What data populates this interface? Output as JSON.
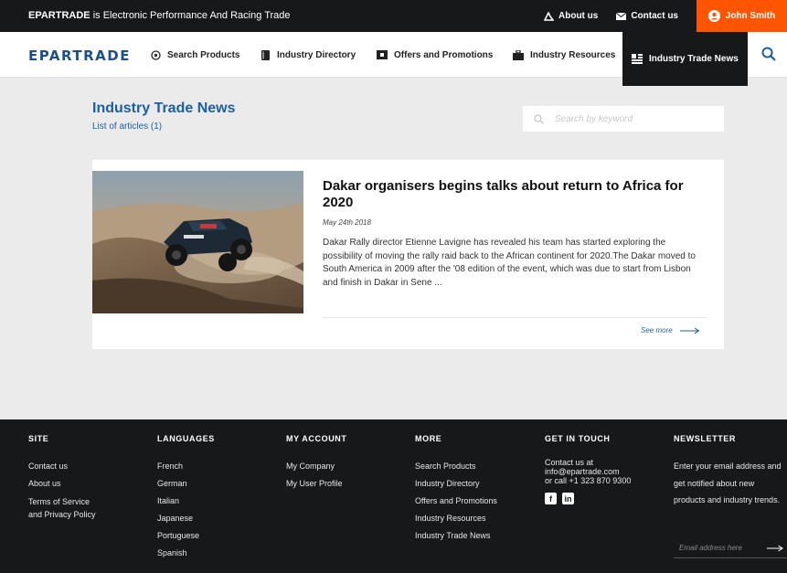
{
  "topbar": {
    "brand": "EPARTRADE",
    "tagline_rest": " is Electronic Performance And Racing Trade",
    "about_label": "About us",
    "contact_label": "Contact us",
    "user_name": "John Smith"
  },
  "nav": {
    "logo_text": "EPARTRADE",
    "items": [
      {
        "label": "Search Products",
        "icon": "target-icon"
      },
      {
        "label": "Industry Directory",
        "icon": "book-icon"
      },
      {
        "label": "Offers and Promotions",
        "icon": "ticket-icon"
      },
      {
        "label": "Industry Resources",
        "icon": "briefcase-icon"
      },
      {
        "label": "Industry Trade News",
        "icon": "news-icon"
      }
    ]
  },
  "main": {
    "title": "Industry Trade News",
    "subtitle": "List of articles (1)",
    "search_placeholder": "Search by keyword"
  },
  "article": {
    "title": "Dakar organisers begins talks about return to Africa for 2020",
    "date": "May 24th 2018",
    "body": "Dakar Rally director Etienne Lavigne has revealed his team has started exploring the possibility of moving the rally raid back to the African continent for 2020.The Dakar moved to South America in 2009 after the '08 edition of the event, which was due to start from Lisbon and finish in Dakar in Sene ...",
    "see_more": "See more"
  },
  "footer": {
    "site": {
      "heading": "SITE",
      "links": [
        "Contact us",
        "About us",
        "Terms of Service",
        "and Privacy Policy"
      ]
    },
    "languages": {
      "heading": "LANGUAGES",
      "links": [
        "French",
        "German",
        "Italian",
        "Japanese",
        "Portuguese",
        "Spanish"
      ]
    },
    "account": {
      "heading": "MY ACCOUNT",
      "links": [
        "My Company",
        "My User Profile"
      ]
    },
    "more": {
      "heading": "MORE",
      "links": [
        "Search Products",
        "Industry Directory",
        "Offers and Promotions",
        "Industry Resources",
        "Industry Trade News"
      ]
    },
    "contact": {
      "heading": "GET IN TOUCH",
      "line1": "Contact us at",
      "line2": "info@epartrade.com",
      "line3": "or call +1 323 870 9300",
      "facebook": "f",
      "linkedin": "in"
    },
    "newsletter": {
      "heading": "NEWSLETTER",
      "text": "Enter your email address and get notified about new products and industry trends.",
      "placeholder": "Email address here"
    }
  },
  "colors": {
    "accent": "#ff5500",
    "brand_blue": "#1c5f9e",
    "dark": "#16181a"
  }
}
